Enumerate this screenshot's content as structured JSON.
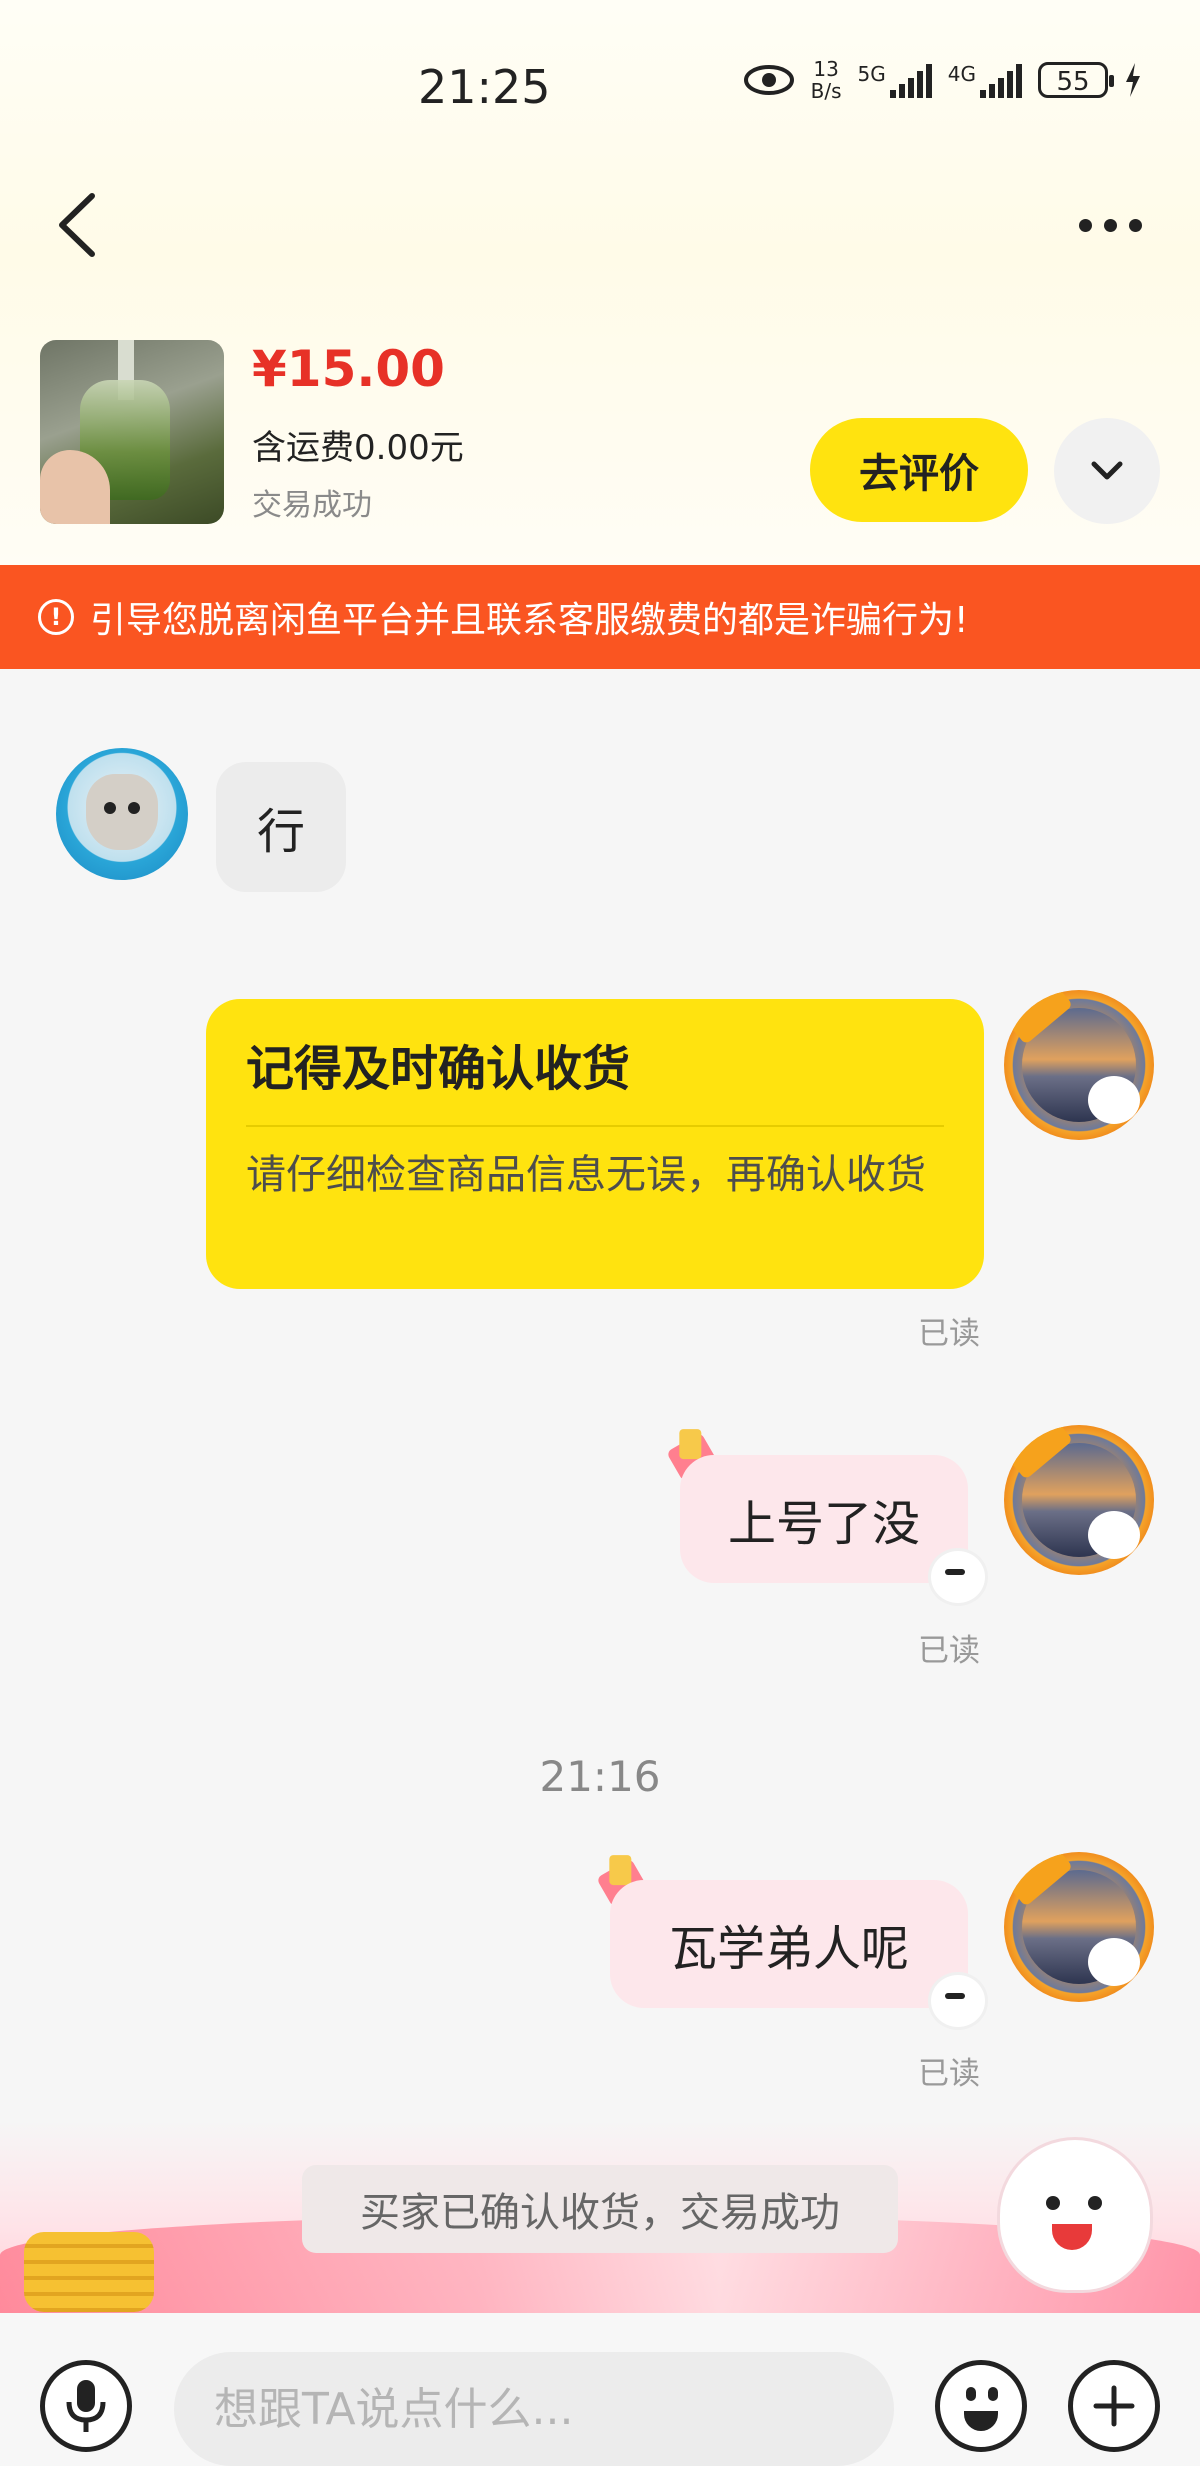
{
  "status_bar": {
    "time": "21:25",
    "net_speed_value": "13",
    "net_speed_unit": "B/s",
    "sim1_label": "5G",
    "sim2_label": "4G",
    "battery": "55"
  },
  "product": {
    "price": "¥15.00",
    "shipping": "含运费0.00元",
    "status": "交易成功",
    "review_button": "去评价"
  },
  "warning_banner": {
    "icon": "exclamation-circle-icon",
    "text": "引导您脱离闲鱼平台并且联系客服缴费的都是诈骗行为!"
  },
  "messages": {
    "seller_reply": "行",
    "confirm_card": {
      "title": "记得及时确认收货",
      "body": "请仔细检查商品信息无误，再确认收货"
    },
    "read_1": "已读",
    "msg_1": "上号了没",
    "read_2": "已读",
    "time_divider": "21:16",
    "msg_2": "瓦学弟人呢",
    "read_3": "已读",
    "system": "买家已确认收货，交易成功"
  },
  "input": {
    "placeholder": "想跟TA说点什么..."
  },
  "colors": {
    "accent_yellow": "#ffe30f",
    "price_red": "#e73127",
    "warning_orange": "#fa5521",
    "my_bubble_pink": "#fde7eb"
  }
}
